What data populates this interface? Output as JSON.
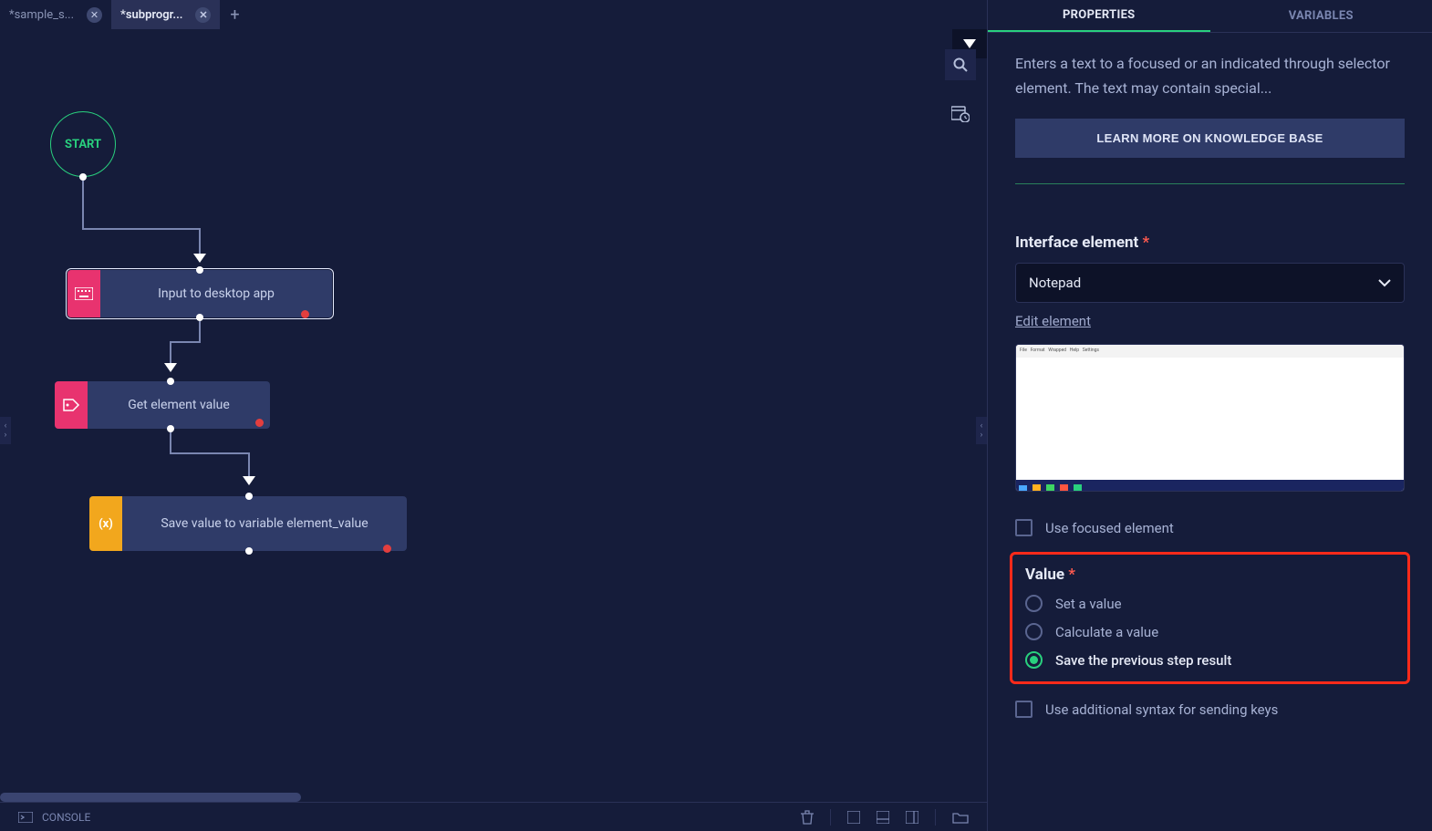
{
  "tabs": {
    "items": [
      {
        "label": "*sample_s..."
      },
      {
        "label": "*subprogr..."
      }
    ],
    "active_index": 1
  },
  "canvas": {
    "start_label": "START",
    "nodes": [
      {
        "label": "Input to desktop app"
      },
      {
        "label": "Get element value"
      },
      {
        "label": "Save value to variable element_value"
      }
    ]
  },
  "bottom": {
    "console_label": "CONSOLE"
  },
  "panel": {
    "tabs": {
      "properties": "PROPERTIES",
      "variables": "VARIABLES"
    },
    "description": "Enters a text to a focused or an indicated through selector element. The text may contain special...",
    "learn_more": "LEARN MORE ON KNOWLEDGE BASE",
    "interface_element": {
      "label": "Interface element",
      "value": "Notepad",
      "edit": "Edit element"
    },
    "use_focused": "Use focused element",
    "value_section": {
      "label": "Value",
      "options": [
        "Set a value",
        "Calculate a value",
        "Save the previous step result"
      ],
      "selected": 2
    },
    "use_syntax": "Use additional syntax for sending keys"
  }
}
